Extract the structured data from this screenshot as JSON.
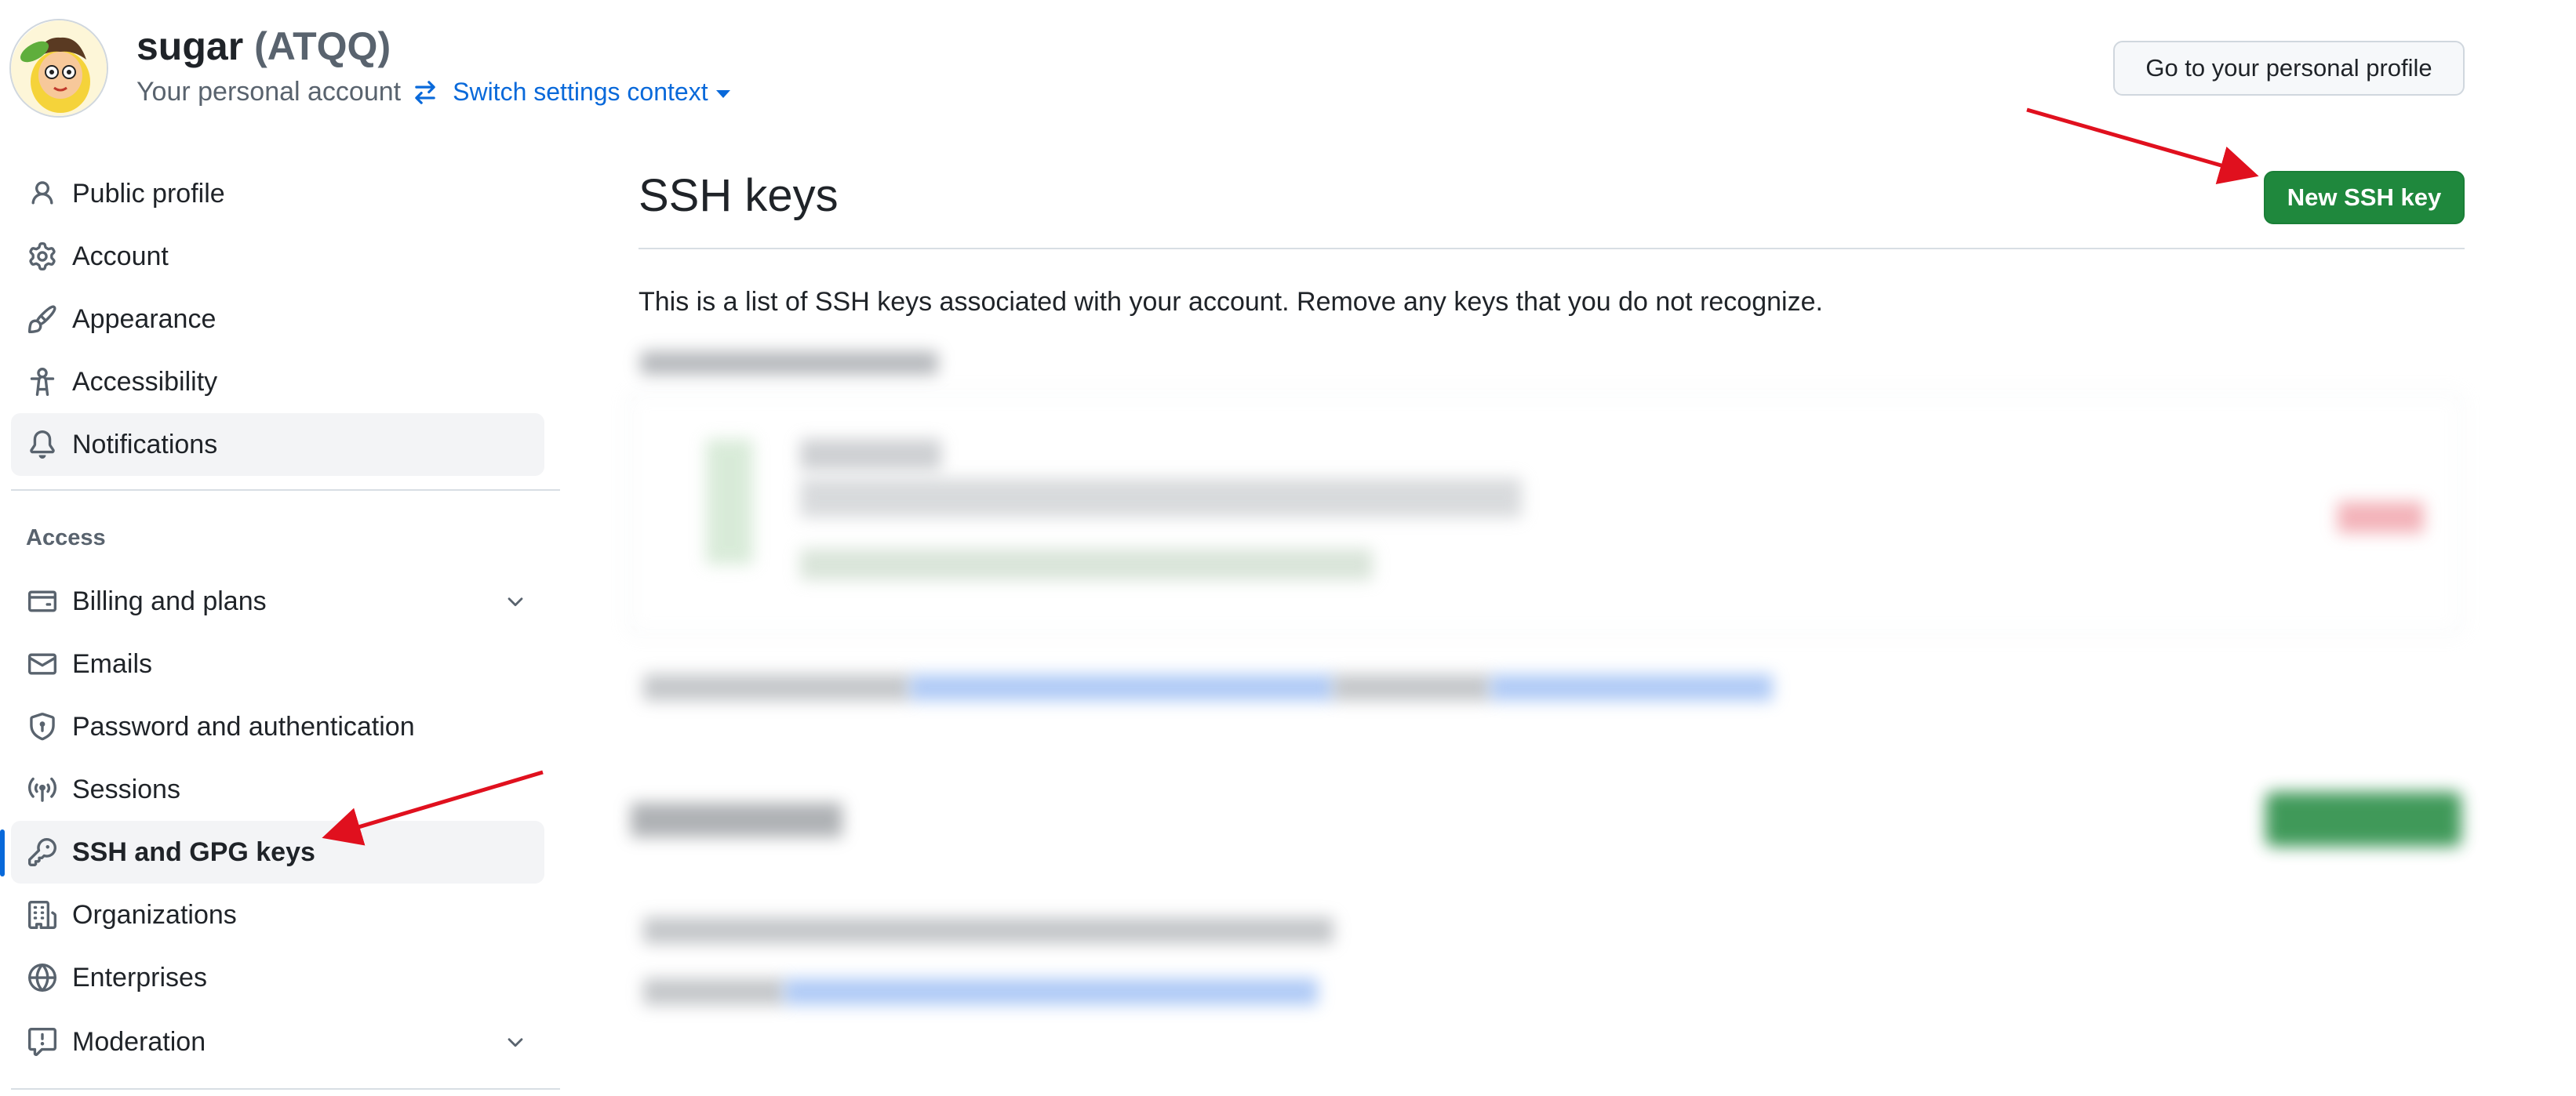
{
  "header": {
    "account_name": "sugar",
    "account_handle": "(ATQQ)",
    "account_subtitle": "Your personal account",
    "switch_context_label": "Switch settings context",
    "profile_button_label": "Go to your personal profile"
  },
  "sidebar": {
    "items": [
      {
        "label": "Public profile",
        "icon": "person-icon"
      },
      {
        "label": "Account",
        "icon": "gear-icon"
      },
      {
        "label": "Appearance",
        "icon": "paintbrush-icon"
      },
      {
        "label": "Accessibility",
        "icon": "accessibility-icon"
      },
      {
        "label": "Notifications",
        "icon": "bell-icon"
      }
    ],
    "access_label": "Access",
    "access_items": [
      {
        "label": "Billing and plans",
        "icon": "credit-card-icon"
      },
      {
        "label": "Emails",
        "icon": "mail-icon"
      },
      {
        "label": "Password and authentication",
        "icon": "shield-lock-icon"
      },
      {
        "label": "Sessions",
        "icon": "broadcast-icon"
      },
      {
        "label": "SSH and GPG keys",
        "icon": "key-icon"
      },
      {
        "label": "Organizations",
        "icon": "organization-icon"
      },
      {
        "label": "Enterprises",
        "icon": "globe-icon"
      },
      {
        "label": "Moderation",
        "icon": "report-icon"
      }
    ]
  },
  "main": {
    "title": "SSH keys",
    "new_key_button": "New SSH key",
    "description": "This is a list of SSH keys associated with your account. Remove any keys that you do not recognize."
  },
  "colors": {
    "primary_button": "#1f883d",
    "link": "#0969da",
    "annotation_arrow": "#e0101e",
    "selection_bar": "#0969da"
  }
}
